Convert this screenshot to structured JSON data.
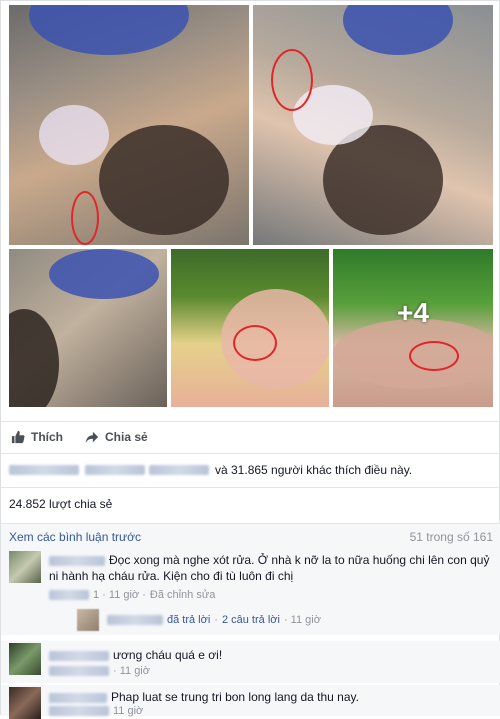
{
  "photos": {
    "more_label": "+4"
  },
  "actions": {
    "like_label": "Thích",
    "share_label": "Chia sẻ"
  },
  "likes": {
    "text": "và 31.865 người khác thích điều này."
  },
  "shares": {
    "text": "24.852 lượt chia sẻ"
  },
  "comments": {
    "view_previous": "Xem các bình luận trước",
    "count": "51 trong số 161",
    "items": [
      {
        "text": "Đọc xong mà nghe xót rửa. Ở nhà k nỡ la to nữa huống chi lên con quỷ ni hành hạ cháu rửa. Kiện cho đi tù luôn đi chị",
        "time": "1 · 11 giờ · ",
        "edit": "Đã chỉnh sửa",
        "replied": "đã trả lời",
        "replies": "2 câu trả lời",
        "reply_time": "· 11 giờ"
      },
      {
        "text": "ương cháu quá e ơi!",
        "time": "· 11 giờ"
      },
      {
        "text": "Phap luat se trung tri bon long lang da thu nay.",
        "time": "11 giờ"
      }
    ]
  },
  "colors": {
    "link": "#365899",
    "muted": "#90949c",
    "circle": "#e0262b"
  }
}
